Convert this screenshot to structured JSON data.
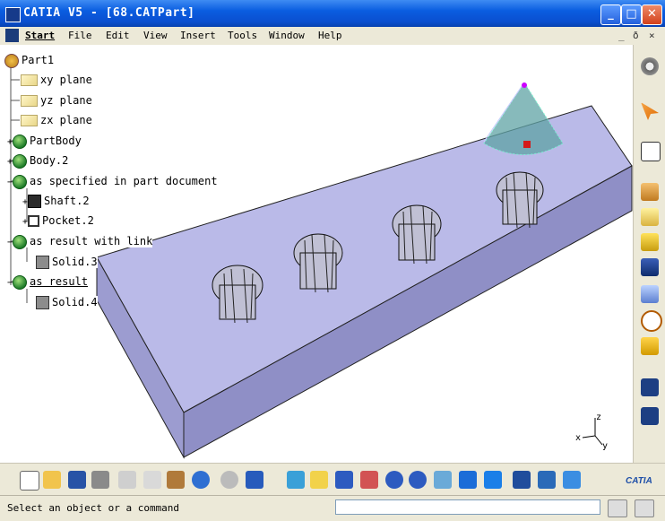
{
  "window": {
    "title": "CATIA V5 - [68.CATPart]",
    "minimize": "_",
    "maximize": "□",
    "close": "✕"
  },
  "menu": {
    "items": [
      "Start",
      "File",
      "Edit",
      "View",
      "Insert",
      "Tools",
      "Window",
      "Help"
    ],
    "mdi": {
      "minimize": "_",
      "restore": "ð",
      "close": "×"
    }
  },
  "tree": {
    "root": "Part1",
    "nodes": [
      {
        "label": "xy plane",
        "icon": "plane-icon"
      },
      {
        "label": "yz plane",
        "icon": "plane-icon"
      },
      {
        "label": "zx plane",
        "icon": "plane-icon"
      },
      {
        "label": "PartBody",
        "icon": "body-icon"
      },
      {
        "label": "Body.2",
        "icon": "body-icon"
      },
      {
        "label": "as specified in part document",
        "icon": "body-icon"
      },
      {
        "label": "Shaft.2",
        "icon": "shaft-icon"
      },
      {
        "label": "Pocket.2",
        "icon": "pocket-icon"
      },
      {
        "label": "as result with link",
        "icon": "body-icon"
      },
      {
        "label": "Solid.3",
        "icon": "solid-icon"
      },
      {
        "label": "as result",
        "icon": "body-icon"
      },
      {
        "label": "Solid.4",
        "icon": "solid-icon"
      }
    ]
  },
  "compass": {
    "x": "x",
    "y": "y",
    "z": "z"
  },
  "right_toolbar": [
    "gear-icon",
    "select-arrow-icon",
    "sketch-icon",
    "pad-icon",
    "pocket-icon",
    "shaft-icon",
    "rib-icon",
    "multi-section-icon",
    "hole-icon",
    "fillet-icon",
    "measure-icon",
    "snapshot-icon"
  ],
  "bottom_toolbar": [
    "new-file-icon",
    "open-folder-icon",
    "save-icon",
    "print-icon",
    "cut-icon",
    "copy-icon",
    "paste-icon",
    "undo-icon",
    "redo-icon",
    "whats-this-icon",
    "fly-mode-icon",
    "fit-all-icon",
    "pan-icon",
    "rotate-icon",
    "zoom-in-icon",
    "zoom-out-icon",
    "normal-view-icon",
    "multi-view-icon",
    "isometric-view-icon",
    "shading-icon",
    "hide-show-icon",
    "swap-space-icon"
  ],
  "status": {
    "message": "Select an object or a command",
    "command_placeholder": ""
  },
  "logo": {
    "text": "CATIA"
  },
  "colors": {
    "plate": "#b9b9e6",
    "plate_side": "#9a9acc",
    "titlebar": "#0a4fd0",
    "ui_bg": "#ece9d8"
  }
}
